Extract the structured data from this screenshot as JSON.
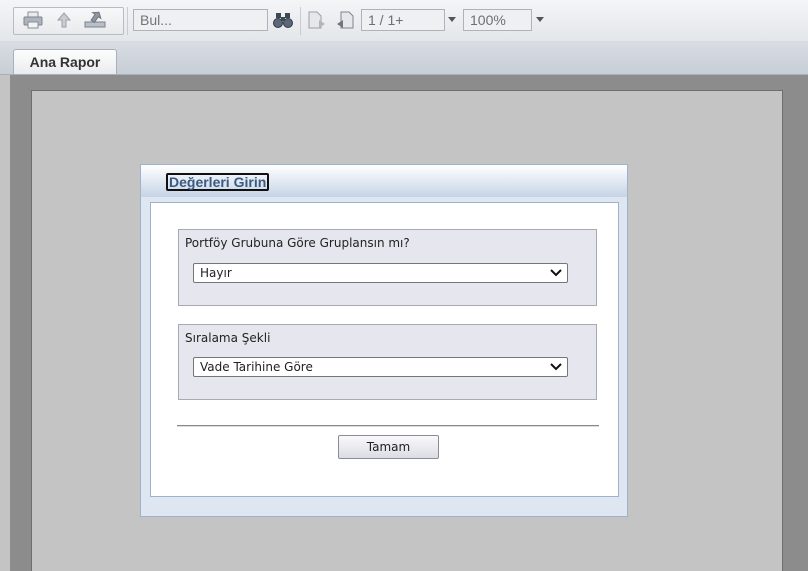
{
  "toolbar": {
    "search": {
      "placeholder": "Bul..."
    },
    "page_indicator": "1 / 1+",
    "zoom": "100%",
    "icons": [
      "print-icon",
      "export-icon",
      "send-icon",
      "find-binoculars-icon",
      "previous-page-icon",
      "next-page-icon"
    ]
  },
  "tabs": [
    {
      "label": "Ana Rapor",
      "active": true
    }
  ],
  "dialog": {
    "title": "Değerleri Girin",
    "params": [
      {
        "label": "Portföy Grubuna Göre Gruplansın mı?",
        "value": "Hayır"
      },
      {
        "label": "Sıralama Şekli",
        "value": "Vade Tarihine Göre"
      }
    ],
    "ok_label": "Tamam"
  },
  "colors": {
    "accent": "#3a5a82",
    "dialog_border": "#9db2cc",
    "param_background": "#e6e6ee",
    "report_background": "#c4c4c4"
  }
}
